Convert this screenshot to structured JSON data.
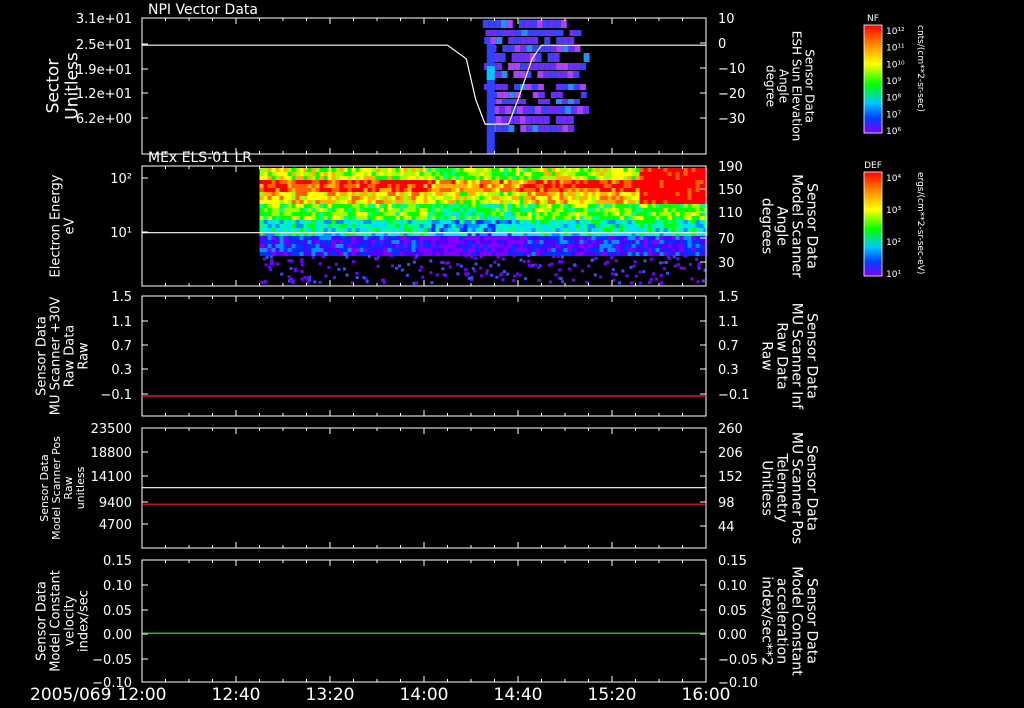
{
  "time_axis": {
    "date_label": "2005/069",
    "ticks": [
      "12:00",
      "12:40",
      "13:20",
      "14:00",
      "14:40",
      "15:20",
      "16:00"
    ],
    "start_hours": 12.0,
    "end_hours": 16.0
  },
  "colorbars": [
    {
      "title": "NF",
      "units": "cnts/(cm**2-sr-sec)",
      "tick_labels": [
        "10¹²",
        "10¹¹",
        "10¹⁰",
        "10⁹",
        "10⁸",
        "10⁷",
        "10⁶"
      ],
      "colors": [
        "#ff0000",
        "#ff8800",
        "#ffff00",
        "#00ff00",
        "#00c8ff",
        "#0040ff",
        "#8000ff"
      ]
    },
    {
      "title": "DEF",
      "units": "ergs/(cm**2-sr-sec-eV)",
      "tick_labels": [
        "10⁴",
        "10³",
        "10²",
        "10¹"
      ],
      "colors": [
        "#ff0000",
        "#ff8800",
        "#ffff00",
        "#00ff00",
        "#00c8ff",
        "#0040ff",
        "#8000ff"
      ]
    }
  ],
  "panels": [
    {
      "title": "NPI Vector Data",
      "left_label": [
        "Sector",
        "Unitless"
      ],
      "left_color": "#ffffff",
      "left_ticks": [
        "3.1e+01",
        "2.5e+01",
        "1.9e+01",
        "1.2e+01",
        "6.2e+00"
      ],
      "right_label": [
        "Sensor Data",
        "ESH Sun Elevation",
        "Angle",
        "degree"
      ],
      "right_color": "#ffffff",
      "right_ticks": [
        "10",
        "0",
        "−10",
        "−20",
        "−30"
      ]
    },
    {
      "title": "MEx ELS-01 LR",
      "left_label": [
        "Electron Energy",
        "eV"
      ],
      "left_color": "#ffffff",
      "left_ticks": [
        "10²",
        "10¹"
      ],
      "right_label": [
        "Sensor Data",
        "Model Scanner",
        "Angle",
        "degrees"
      ],
      "right_color": "#ffffff",
      "right_ticks": [
        "190",
        "150",
        "110",
        "70",
        "30"
      ]
    },
    {
      "title": "",
      "left_label": [
        "Sensor Data",
        "MU Scanner +30V",
        "Raw Data",
        "Raw"
      ],
      "left_color": "#ffffff",
      "left_ticks": [
        "1.5",
        "1.1",
        "0.7",
        "0.3",
        "−0.1"
      ],
      "right_label": [
        "Sensor Data",
        "MU Scanner Inf",
        "Raw Data",
        "Raw"
      ],
      "right_color": "#ff2020",
      "right_ticks": [
        "1.5",
        "1.1",
        "0.7",
        "0.3",
        "−0.1"
      ]
    },
    {
      "title": "",
      "left_label": [
        "Sensor Data",
        "Model Scanner Pos",
        "Raw",
        "unitless"
      ],
      "left_color": "#ffffff",
      "left_ticks": [
        "23500",
        "18800",
        "14100",
        "9400",
        "4700"
      ],
      "right_label": [
        "Sensor Data",
        "MU Scanner Pos",
        "Telemetry",
        "Unitless"
      ],
      "right_color": "#ff2020",
      "right_ticks": [
        "260",
        "206",
        "152",
        "98",
        "44"
      ]
    },
    {
      "title": "",
      "left_label": [
        "Sensor Data",
        "Model Constant",
        "velocity",
        "index/sec"
      ],
      "left_color": "#ffffff",
      "left_ticks": [
        "0.15",
        "0.10",
        "0.05",
        "0.00",
        "−0.05",
        "−0.10"
      ],
      "right_label": [
        "Sensor Data",
        "Model Constant",
        "acceleration",
        "index/sec**2"
      ],
      "right_color": "#20ff20",
      "right_ticks": [
        "0.15",
        "0.10",
        "0.05",
        "0.00",
        "−0.05",
        "−0.10"
      ]
    }
  ],
  "chart_data": [
    {
      "type": "line",
      "title": "NPI Vector Data",
      "ylabel": "Sector Unitless",
      "ylabel_right": "Sensor Data ESH Sun Elevation Angle degree",
      "ylim_right": [
        -40,
        10
      ],
      "series": [
        {
          "name": "ESH Sun Elevation Angle",
          "color": "#ffffff",
          "x": [
            "12:00",
            "14:10",
            "14:18",
            "14:22",
            "14:26",
            "14:30",
            "14:36",
            "14:40",
            "14:46",
            "14:50",
            "14:55",
            "16:00"
          ],
          "y": [
            0,
            0,
            -5,
            -20,
            -29,
            -29,
            -29,
            -20,
            -5,
            0,
            0,
            0
          ]
        }
      ],
      "spectrogram_coverage": {
        "start": "14:25",
        "end": "15:10"
      }
    },
    {
      "type": "heatmap",
      "title": "MEx ELS-01 LR",
      "ylabel": "Electron Energy eV",
      "ylabel_right": "Sensor Data Model Scanner Angle degrees",
      "ylim_right": [
        10,
        190
      ],
      "series": [
        {
          "name": "Model Scanner Angle",
          "color": "#ffffff",
          "x": [
            "12:00",
            "16:00"
          ],
          "y": [
            90,
            90
          ]
        }
      ],
      "spectrogram_coverage": {
        "start": "12:50",
        "end": "16:00"
      }
    },
    {
      "type": "line",
      "ylabel": "Sensor Data MU Scanner +30V Raw Data Raw",
      "ylabel_right": "Sensor Data MU Scanner Inf Raw Data Raw",
      "ylim": [
        -0.3,
        1.5
      ],
      "series": [
        {
          "name": "MU Scanner Inf Raw Data",
          "color": "#ff2020",
          "x": [
            "12:00",
            "16:00"
          ],
          "y": [
            0.0,
            0.0
          ]
        }
      ]
    },
    {
      "type": "line",
      "ylabel": "Sensor Data Model Scanner Pos Raw unitless",
      "ylabel_right": "Sensor Data MU Scanner Pos Telemetry Unitless",
      "ylim": [
        0,
        23500
      ],
      "ylim_right": [
        0,
        260
      ],
      "series": [
        {
          "name": "Model Scanner Pos",
          "color": "#ffffff",
          "axis": "left",
          "x": [
            "12:00",
            "16:00"
          ],
          "y": [
            11800,
            11800
          ]
        },
        {
          "name": "MU Scanner Pos Telemetry",
          "color": "#ff2020",
          "axis": "right",
          "x": [
            "12:00",
            "16:00"
          ],
          "y": [
            95,
            95
          ]
        }
      ]
    },
    {
      "type": "line",
      "ylabel": "Sensor Data Model Constant velocity index/sec",
      "ylabel_right": "Sensor Data Model Constant acceleration index/sec**2",
      "ylim": [
        -0.1,
        0.15
      ],
      "series": [
        {
          "name": "Model Constant acceleration",
          "color": "#20ff20",
          "x": [
            "12:00",
            "16:00"
          ],
          "y": [
            0.0,
            0.0
          ]
        }
      ]
    }
  ]
}
